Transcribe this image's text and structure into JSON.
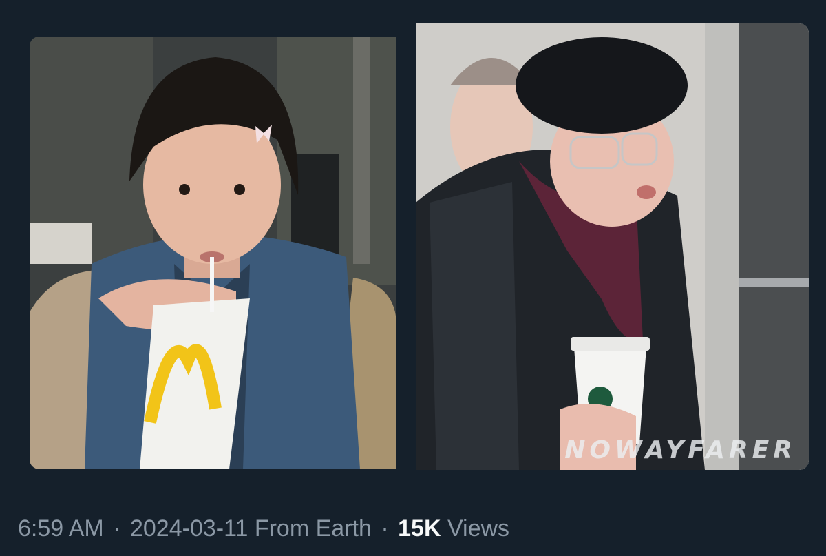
{
  "tweet": {
    "media": [
      {
        "caption": "",
        "watermark": ""
      },
      {
        "caption": "",
        "watermark": "NOWAYFARER"
      }
    ],
    "meta": {
      "time": "6:59 AM",
      "separator": "·",
      "date": "2024-03-11",
      "source": "From Earth",
      "views_count": "15K",
      "views_label": "Views"
    }
  },
  "colors": {
    "background": "#15202b",
    "meta_text": "#8b98a5",
    "emphasis_text": "#f7f9f9"
  }
}
